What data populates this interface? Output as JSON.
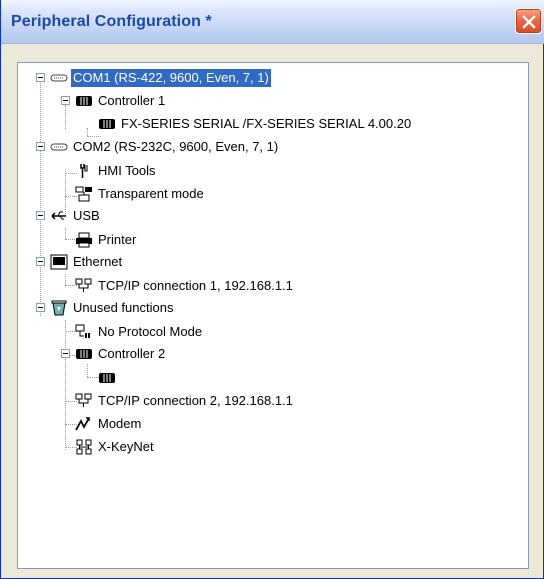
{
  "window": {
    "title": "Peripheral Configuration *"
  },
  "tree": {
    "com1": {
      "label": "COM1 (RS-422, 9600, Even, 7, 1)"
    },
    "controller1": {
      "label": "Controller 1"
    },
    "fx_series": {
      "label": "FX-SERIES SERIAL /FX-SERIES SERIAL  4.00.20"
    },
    "com2": {
      "label": "COM2 (RS-232C, 9600, Even, 7, 1)"
    },
    "hmi_tools": {
      "label": "HMI Tools"
    },
    "transparent_mode": {
      "label": "Transparent mode"
    },
    "usb": {
      "label": "USB"
    },
    "printer": {
      "label": "Printer"
    },
    "ethernet": {
      "label": "Ethernet"
    },
    "tcpip1": {
      "label": "TCP/IP connection 1, 192.168.1.1"
    },
    "unused": {
      "label": "Unused functions"
    },
    "no_protocol": {
      "label": "No Protocol Mode"
    },
    "controller2": {
      "label": "Controller 2"
    },
    "tcpip2": {
      "label": "TCP/IP connection 2, 192.168.1.1"
    },
    "modem": {
      "label": "Modem"
    },
    "xkeynet": {
      "label": "X-KeyNet"
    }
  },
  "colors": {
    "selection": "#316ac5",
    "title_text": "#1a4aa8",
    "close_button": "#e96a43"
  }
}
